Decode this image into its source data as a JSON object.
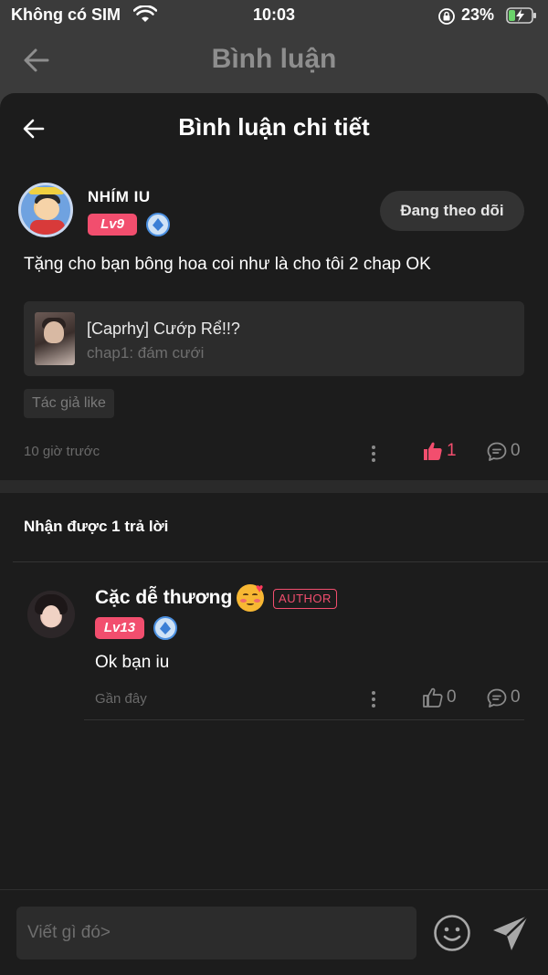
{
  "status_bar": {
    "carrier": "Không có SIM",
    "time": "10:03",
    "battery": "23%",
    "icons": [
      "wifi-icon",
      "orientation-lock-icon",
      "battery-charging-icon"
    ]
  },
  "background_header": {
    "title": "Bình luận"
  },
  "sheet": {
    "title": "Bình luận chi tiết"
  },
  "main_comment": {
    "user_name": "NHÍM IU",
    "level": "Lv9",
    "follow_label": "Đang theo dõi",
    "text": "Tặng cho bạn bông hoa coi như là cho tôi 2 chap OK",
    "chapter": {
      "title": "[Caprhy] Cướp Rể!!?",
      "subtitle": "chap1: đám cưới"
    },
    "tag": "Tác giả like",
    "time": "10 giờ trước",
    "like_count": "1",
    "reply_count": "0"
  },
  "replies": {
    "heading": "Nhận được 1 trả lời",
    "items": [
      {
        "user_name": "Cặc dễ thương",
        "author_badge": "AUTHOR",
        "level": "Lv13",
        "text": "Ok bạn iu",
        "time": "Gần đây",
        "like_count": "0",
        "reply_count": "0"
      }
    ]
  },
  "input": {
    "placeholder": "Viết gì đó>"
  },
  "colors": {
    "accent": "#f24e6e",
    "sheet_bg": "#1c1c1c",
    "card_bg": "#2c2c2c"
  }
}
